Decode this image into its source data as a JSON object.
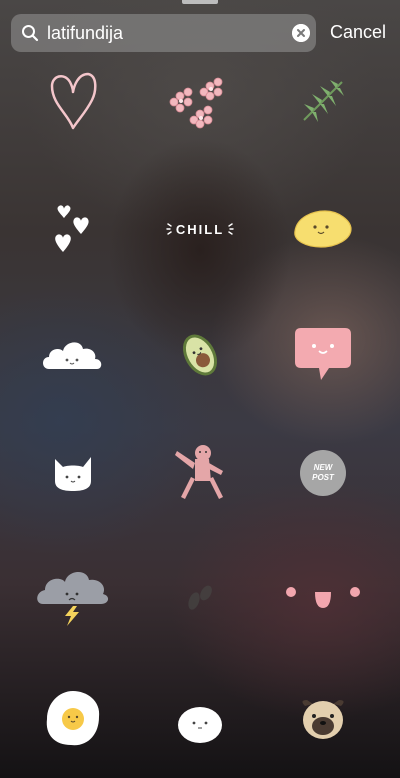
{
  "search": {
    "value": "latifundija",
    "cancel_label": "Cancel"
  },
  "stickers": {
    "chill_text": "CHILL",
    "new_post_line1": "NEW",
    "new_post_line2": "POST"
  },
  "colors": {
    "search_bg": "#969696",
    "text": "#ffffff",
    "sticker_pink": "#f2b8be",
    "sticker_yellow": "#f7de6f",
    "avocado_green": "#8fa36a",
    "leaf_green": "#7fb06e"
  }
}
